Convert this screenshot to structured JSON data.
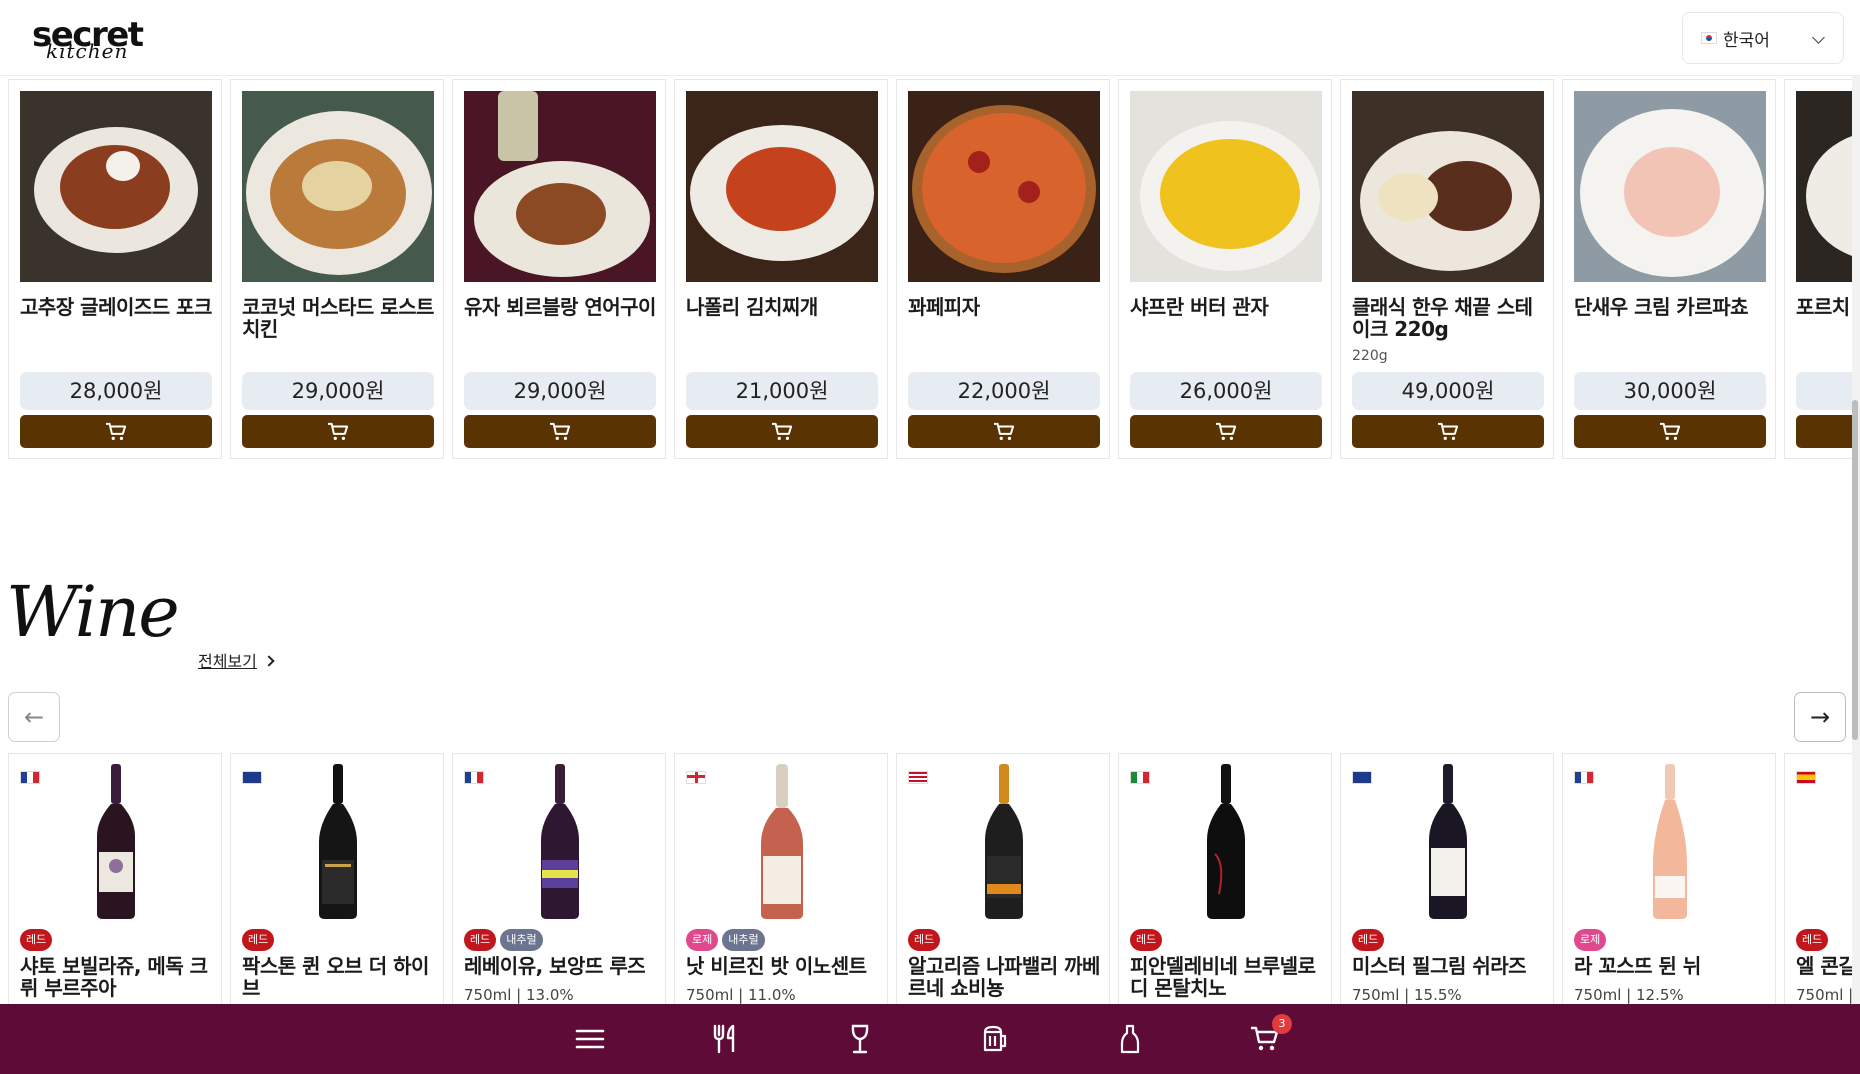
{
  "header": {
    "logo_top": "secret",
    "logo_bottom": "kitchen",
    "language": "한국어"
  },
  "food": {
    "items": [
      {
        "name": "고추장 글레이즈드 포크",
        "sub": "",
        "price": "28,000원"
      },
      {
        "name": "코코넛 머스타드 로스트 치킨",
        "sub": "",
        "price": "29,000원"
      },
      {
        "name": "유자 뵈르블랑 연어구이",
        "sub": "",
        "price": "29,000원"
      },
      {
        "name": "나폴리 김치찌개",
        "sub": "",
        "price": "21,000원"
      },
      {
        "name": "꽈페피자",
        "sub": "",
        "price": "22,000원"
      },
      {
        "name": "샤프란 버터 관자",
        "sub": "",
        "price": "26,000원"
      },
      {
        "name": "클래식 한우 채끝 스테이크 220g",
        "sub": "220g",
        "price": "49,000원"
      },
      {
        "name": "단새우 크림 카르파쵸",
        "sub": "",
        "price": "30,000원"
      },
      {
        "name": "포르치",
        "sub": "",
        "price": ""
      }
    ]
  },
  "wine": {
    "title": "Wine",
    "view_all": "전체보기",
    "prev_label": "←",
    "next_label": "→",
    "items": [
      {
        "flag": "FR",
        "tags": [
          "레드"
        ],
        "name": "샤토 보빌라쥬, 메독 크뤼 부르주아",
        "meta": ""
      },
      {
        "flag": "AU",
        "tags": [
          "레드"
        ],
        "name": "팍스톤 퀸 오브 더 하이브",
        "meta": ""
      },
      {
        "flag": "FR",
        "tags": [
          "레드",
          "내추럴"
        ],
        "name": "레베이유, 보앙뜨 루즈",
        "meta": "750ml | 13.0%"
      },
      {
        "flag": "GB",
        "tags": [
          "로제",
          "내추럴"
        ],
        "name": "낫 비르진 밧 이노센트",
        "meta": "750ml | 11.0%"
      },
      {
        "flag": "US",
        "tags": [
          "레드"
        ],
        "name": "알고리즘 나파밸리 까베르네 쇼비뇽",
        "meta": ""
      },
      {
        "flag": "IT",
        "tags": [
          "레드"
        ],
        "name": "피안델레비네 브루넬로 디 몬탈치노",
        "meta": ""
      },
      {
        "flag": "AU",
        "tags": [
          "레드"
        ],
        "name": "미스터 필그림 쉬라즈",
        "meta": "750ml | 15.5%"
      },
      {
        "flag": "FR",
        "tags": [
          "로제"
        ],
        "name": "라 꼬스뜨 뒨 뉘",
        "meta": "750ml | 12.5%"
      },
      {
        "flag": "ES",
        "tags": [
          "레드"
        ],
        "name": "엘 콘길",
        "meta": "750ml |"
      }
    ]
  },
  "nav": {
    "items": [
      "menu-icon",
      "dining-icon",
      "wine-glass-icon",
      "beer-icon",
      "bottle-icon",
      "cart-icon"
    ],
    "cart_count": "3"
  },
  "colors": {
    "brown": "#5a3303",
    "nav_bg": "#5e0b37",
    "price_bg": "#e7ecf3",
    "tag_red": "#c1161b",
    "tag_rose": "#e0498d",
    "tag_natural": "#6c7590"
  }
}
